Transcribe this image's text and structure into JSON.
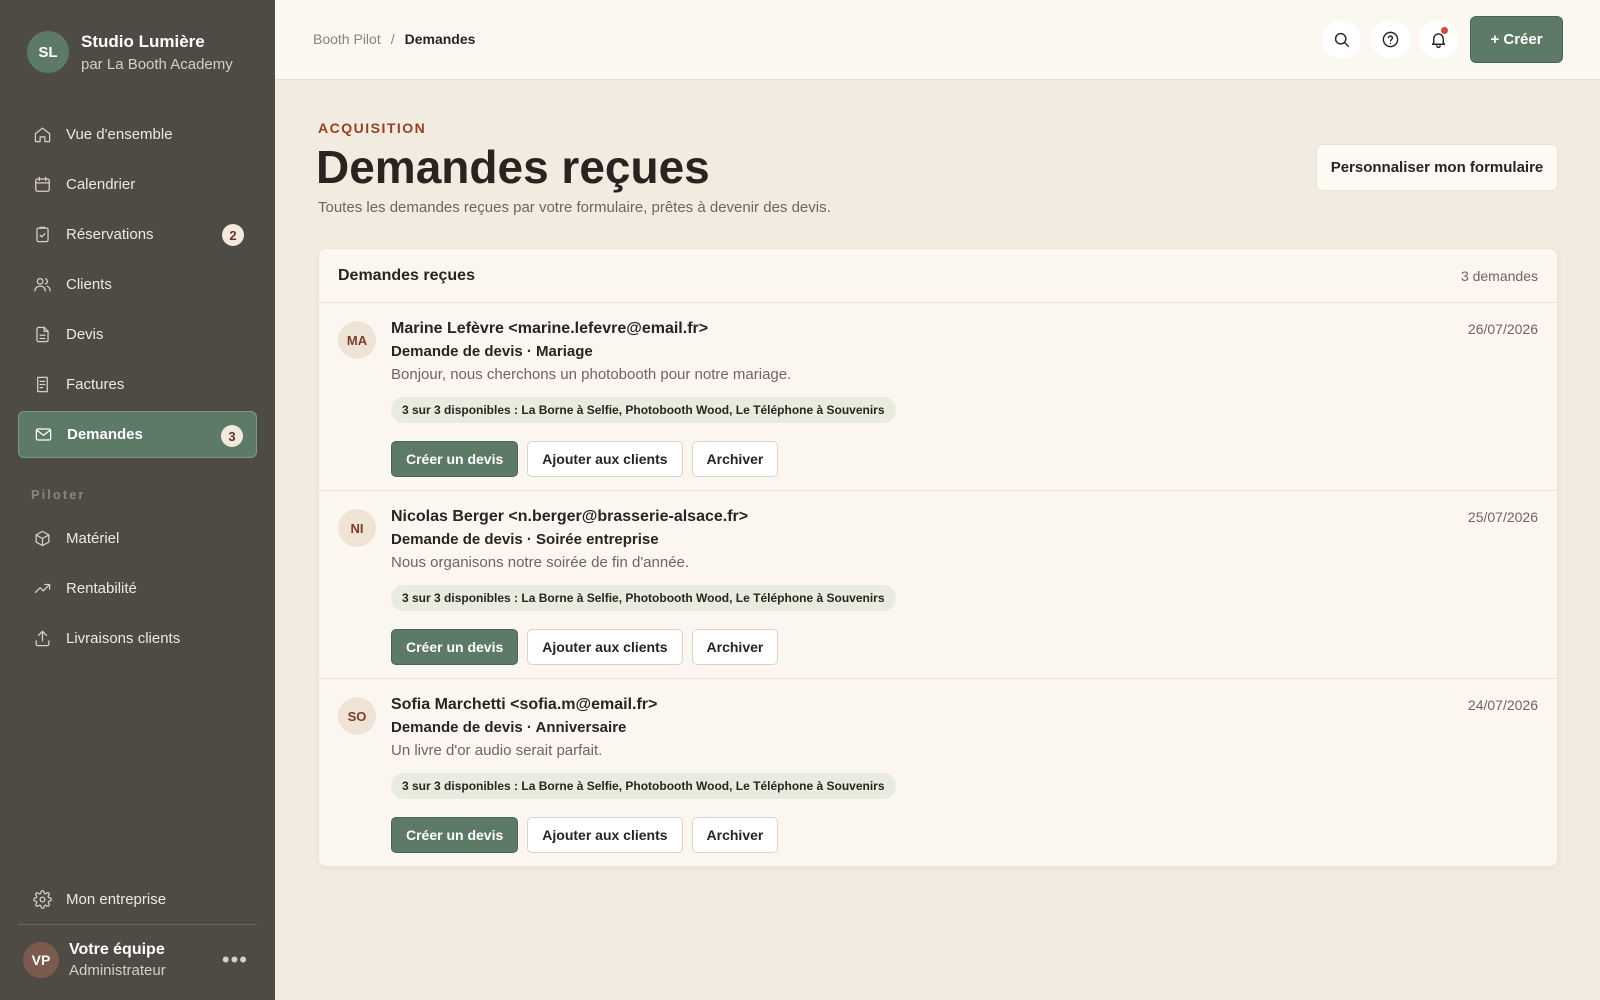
{
  "brand": {
    "initials": "SL",
    "name": "Studio Lumière",
    "subtitle": "par La Booth Academy"
  },
  "sidebar": {
    "items": [
      {
        "label": "Vue d'ensemble",
        "icon": "home-icon"
      },
      {
        "label": "Calendrier",
        "icon": "calendar-icon"
      },
      {
        "label": "Réservations",
        "icon": "clipboard-check-icon",
        "badge": "2"
      },
      {
        "label": "Clients",
        "icon": "users-icon"
      },
      {
        "label": "Devis",
        "icon": "document-icon"
      },
      {
        "label": "Factures",
        "icon": "receipt-icon"
      },
      {
        "label": "Demandes",
        "icon": "mail-icon",
        "badge": "3",
        "active": true
      }
    ],
    "section_label": "Piloter",
    "pilot_items": [
      {
        "label": "Matériel",
        "icon": "box-icon"
      },
      {
        "label": "Rentabilité",
        "icon": "trending-up-icon"
      },
      {
        "label": "Livraisons clients",
        "icon": "upload-icon"
      }
    ],
    "settings_label": "Mon entreprise",
    "user": {
      "initials": "VP",
      "name": "Votre équipe",
      "role": "Administrateur",
      "more": "•••"
    }
  },
  "topbar": {
    "breadcrumb_root": "Booth Pilot",
    "breadcrumb_sep": "/",
    "breadcrumb_current": "Demandes",
    "create_label": "+ Créer"
  },
  "header": {
    "eyebrow": "ACQUISITION",
    "title": "Demandes reçues",
    "subtitle": "Toutes les demandes reçues par votre formulaire, prêtes à devenir des devis.",
    "customize_label": "Personnaliser mon formulaire"
  },
  "card": {
    "title": "Demandes reçues",
    "count": "3 demandes",
    "requests": [
      {
        "initials": "MA",
        "from": "Marine Lefèvre <marine.lefevre@email.fr>",
        "type": "Demande de devis · Mariage",
        "message": "Bonjour, nous cherchons un photobooth pour notre mariage.",
        "date": "26/07/2026",
        "availability": "3 sur 3 disponibles : La Borne à Selfie, Photobooth Wood, Le Téléphone à Souvenirs"
      },
      {
        "initials": "NI",
        "from": "Nicolas Berger <n.berger@brasserie-alsace.fr>",
        "type": "Demande de devis · Soirée entreprise",
        "message": "Nous organisons notre soirée de fin d'année.",
        "date": "25/07/2026",
        "availability": "3 sur 3 disponibles : La Borne à Selfie, Photobooth Wood, Le Téléphone à Souvenirs"
      },
      {
        "initials": "SO",
        "from": "Sofia Marchetti <sofia.m@email.fr>",
        "type": "Demande de devis · Anniversaire",
        "message": "Un livre d'or audio serait parfait.",
        "date": "24/07/2026",
        "availability": "3 sur 3 disponibles : La Borne à Selfie, Photobooth Wood, Le Téléphone à Souvenirs"
      }
    ],
    "actions": {
      "create_quote": "Créer un devis",
      "add_client": "Ajouter aux clients",
      "archive": "Archiver"
    }
  },
  "colors": {
    "accent": "#5d7a67",
    "sidebar": "#4e4a44",
    "eyebrow": "#9a3e24",
    "background": "#f2ebe0"
  }
}
